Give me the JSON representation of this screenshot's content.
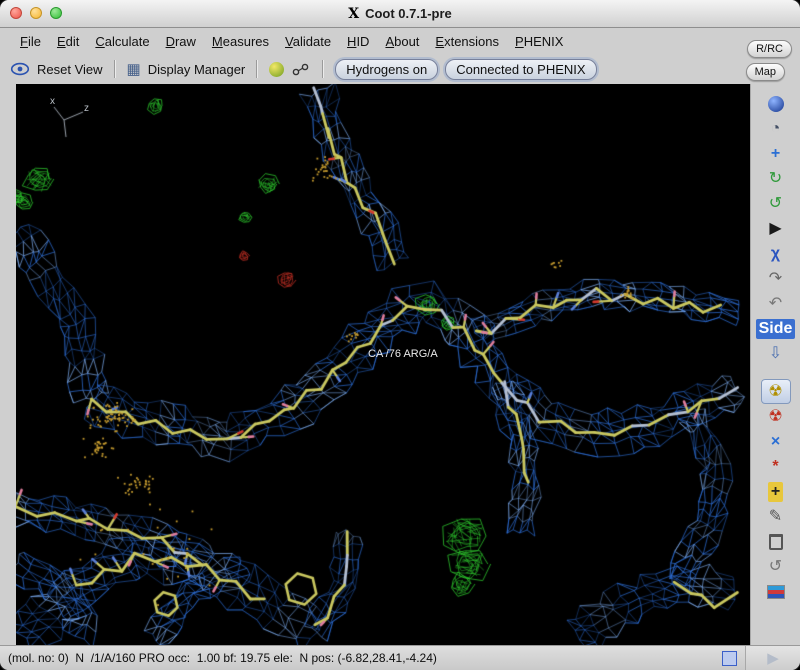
{
  "window": {
    "title": "Coot 0.7.1-pre",
    "icon_glyph": "X"
  },
  "menubar": {
    "items": [
      {
        "id": "file",
        "label": "File"
      },
      {
        "id": "edit",
        "label": "Edit"
      },
      {
        "id": "calculate",
        "label": "Calculate"
      },
      {
        "id": "draw",
        "label": "Draw"
      },
      {
        "id": "measures",
        "label": "Measures"
      },
      {
        "id": "validate",
        "label": "Validate"
      },
      {
        "id": "hid",
        "label": "HID"
      },
      {
        "id": "about",
        "label": "About"
      },
      {
        "id": "extensions",
        "label": "Extensions"
      },
      {
        "id": "phenix",
        "label": "PHENIX"
      }
    ]
  },
  "toolbar": {
    "reset_view": "Reset View",
    "display_manager": "Display Manager",
    "hydrogens": "Hydrogens on",
    "phenix": "Connected to PHENIX"
  },
  "icons": {
    "display_manager": "▦",
    "play": "▶"
  },
  "floating": {
    "rrc": "R/RC",
    "map": "Map"
  },
  "scene": {
    "residue_label": "CA /76 ARG/A",
    "axis_x": "x",
    "axis_z": "z",
    "colors": {
      "background": "#000000",
      "density_2fofc": "#2d6fd8",
      "density_2fofc_hi": "#7fb0f5",
      "density_pos": "#2fd02f",
      "density_neg": "#d03226",
      "bonds": "#c9c75f",
      "bond_alt": "#b4bfd2",
      "tip_pink": "#e07e9e",
      "tip_red": "#d23a2e",
      "tip_blue": "#5a7fd8",
      "waters": "#c49a2e"
    }
  },
  "sidebar": {
    "items": [
      {
        "name": "navigation-sphere-icon",
        "shape": "ball"
      },
      {
        "name": "view-clock-icon",
        "glyph": "◔",
        "color": "#445066"
      },
      {
        "name": "translate-axes-icon",
        "glyph": "+",
        "color": "#2b6fd4",
        "bold": true
      },
      {
        "name": "rotate-zone-icon",
        "glyph": "↻",
        "color": "#2f9a3a"
      },
      {
        "name": "torsion-general-icon",
        "glyph": "↺",
        "color": "#2f9a3a"
      },
      {
        "name": "play-path-icon",
        "glyph": "▶",
        "color": "#1a1a1a"
      },
      {
        "name": "chi-angles-icon",
        "glyph": "χ",
        "color": "#2b55c0",
        "bold": true
      },
      {
        "name": "auto-fit-rotamer-icon",
        "glyph": "↷",
        "color": "#666666"
      },
      {
        "name": "rotamer-cycle-icon",
        "glyph": "↶",
        "color": "#777777"
      },
      {
        "name": "side-chain-180-icon",
        "glyph": "Side",
        "shape": "label",
        "bg": "#3a6fd0",
        "color": "#ffffff"
      },
      {
        "name": "down-arrow-icon",
        "glyph": "⇩",
        "color": "#4a6fb0"
      },
      {
        "name": "sidebar-spacer",
        "sep": true
      },
      {
        "name": "real-space-refine-icon",
        "glyph": "☢",
        "color": "#b08f00",
        "selected": true
      },
      {
        "name": "regularize-zone-icon",
        "glyph": "☢",
        "color": "#c03020"
      },
      {
        "name": "rigid-body-fit-icon",
        "glyph": "×",
        "color": "#2b6fd4",
        "bold": true
      },
      {
        "name": "mutate-icon",
        "glyph": "*",
        "color": "#c03020",
        "bold": true
      },
      {
        "name": "add-terminal-residue-icon",
        "glyph": "+",
        "shape": "label",
        "bg": "#e8c73c",
        "color": "#222222",
        "bold": true
      },
      {
        "name": "pencil-icon",
        "glyph": "✎",
        "color": "#555555"
      },
      {
        "name": "delete-trash-icon",
        "shape": "trash"
      },
      {
        "name": "undo-icon",
        "glyph": "↺",
        "color": "#777777"
      },
      {
        "name": "display-images-icon",
        "shape": "flag"
      }
    ]
  },
  "status_bar": {
    "text": "(mol. no: 0)  N  /1/A/160 PRO occ:  1.00 bf: 19.75 ele:  N pos: (-6.82,28.41,-4.24)"
  }
}
